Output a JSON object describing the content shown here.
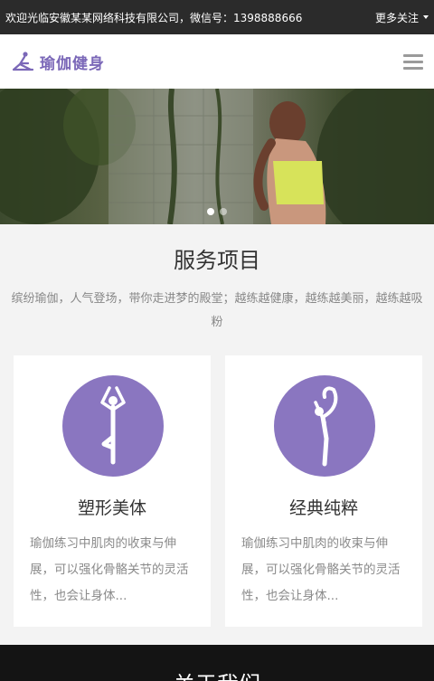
{
  "topbar": {
    "welcome": "欢迎光临安徽某某网络科技有限公司，微信号：1398888666",
    "more_label": "更多关注"
  },
  "header": {
    "logo_text": "瑜伽健身",
    "logo_icon": "yoga-pose-icon",
    "menu_icon": "hamburger-menu-icon"
  },
  "banner": {
    "slide_count": 2,
    "active_slide": 1
  },
  "services": {
    "title": "服务项目",
    "description": "缤纷瑜伽，人气登场，带你走进梦的殿堂；越练越健康，越练越美丽，越练越吸粉",
    "cards": [
      {
        "icon": "yoga-tree-pose-icon",
        "title": "塑形美体",
        "desc": "瑜伽练习中肌肉的收束与伸展，可以强化骨骼关节的灵活性，也会让身体..."
      },
      {
        "icon": "yoga-dancer-pose-icon",
        "title": "经典纯粹",
        "desc": "瑜伽练习中肌肉的收束与伸展，可以强化骨骼关节的灵活性，也会让身体..."
      }
    ]
  },
  "about": {
    "title": "关于我们"
  },
  "colors": {
    "accent": "#8a76c0",
    "topbar_bg": "#2b2b2b",
    "page_bg": "#f3f3f3"
  }
}
